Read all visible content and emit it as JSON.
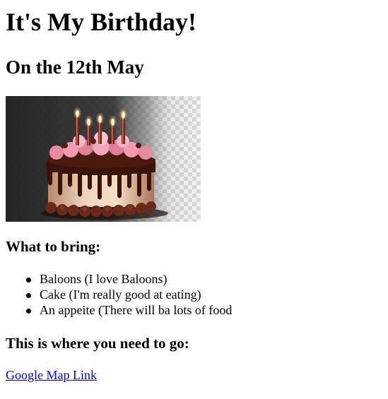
{
  "header": {
    "title": "It's My Birthday!",
    "date": "On the 12th May"
  },
  "image": {
    "icon": "birthday-cake-image"
  },
  "bring": {
    "heading": "What to bring:",
    "items": [
      "Baloons (I love Baloons)",
      "Cake (I'm really good at eating)",
      "An appeite (There will ba lots of food"
    ]
  },
  "location": {
    "heading": "This is where you need to go:",
    "link_label": "Google Map Link"
  },
  "colors": {
    "link": "#0000ee",
    "text": "#000000",
    "background": "#ffffff"
  }
}
